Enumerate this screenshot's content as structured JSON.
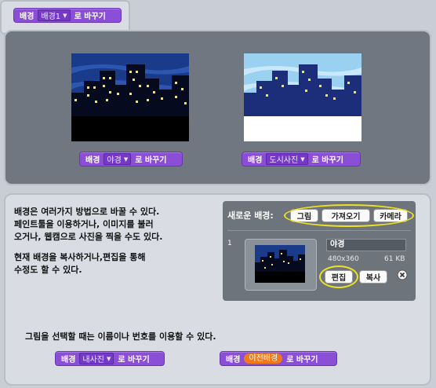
{
  "top_block": {
    "word": "배경",
    "selector": "배경1",
    "action": "로 바꾸기"
  },
  "thumb_left_block": {
    "word": "배경",
    "selector": "야경",
    "action": "로 바꾸기"
  },
  "thumb_right_block": {
    "word": "배경",
    "selector": "도시사진",
    "action": "로 바꾸기"
  },
  "description": {
    "line1": "배경은 여러가지 방법으로 바꿀 수 있다.",
    "line2": "페인트툴을 이용하거나, 이미지를 불러",
    "line3": "오거나, 웹캠으로 사진을 찍을 수도 있다.",
    "line4": "현재 배경을 복사하거나,편집을 통해",
    "line5": "수정도 할 수 있다."
  },
  "editor": {
    "new_label": "새로운 배경:",
    "paint": "그림",
    "import": "가져오기",
    "camera": "카메라",
    "index": "1",
    "name": "야경",
    "dimensions": "480x360",
    "size": "61 KB",
    "edit": "편집",
    "copy": "복사",
    "delete_icon": "circle-x"
  },
  "bottom_text": "그림을 선택할 때는 이름이나 번호를 이용할 수 있다.",
  "bottom_left_block": {
    "word": "배경",
    "selector": "내사진",
    "action": "로 바꾸기"
  },
  "bottom_right_block": {
    "word": "배경",
    "pill": "이전배경",
    "action": "로 바꾸기"
  },
  "colors": {
    "block": "#8a4fd6",
    "pill": "#f07a1a",
    "highlight": "#ece024",
    "sky_night": "#1a3a8a",
    "sky_day": "#9ad0f0"
  }
}
